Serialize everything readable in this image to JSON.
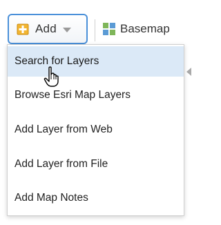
{
  "toolbar": {
    "add_label": "Add",
    "basemap_label": "Basemap"
  },
  "icons": {
    "add": "plus-document-icon",
    "add_caret": "chevron-down-icon",
    "basemap": "grid-icon",
    "cursor": "hand-pointer-icon"
  },
  "colors": {
    "add_border": "#4a90d9",
    "menu_active_bg": "#dbe9f7",
    "plus_icon_fill": "#f2b531"
  },
  "menu": {
    "items": [
      {
        "label": "Search for Layers",
        "active": true
      },
      {
        "label": "Browse Esri Map Layers",
        "active": false
      },
      {
        "label": "Add Layer from Web",
        "active": false
      },
      {
        "label": "Add Layer from File",
        "active": false
      },
      {
        "label": "Add Map Notes",
        "active": false
      }
    ]
  }
}
